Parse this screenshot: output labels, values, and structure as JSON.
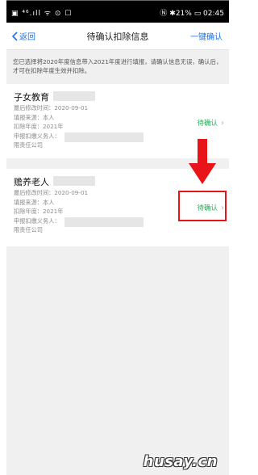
{
  "status_bar": {
    "left": "▣ ⁴⁶.ıll ᯤ ⊙ ☐",
    "right": "Ⓝ ✱21% ▭ 02:45"
  },
  "nav": {
    "back": "返回",
    "title": "待确认扣除信息",
    "confirm_all": "一键确认"
  },
  "notice": "您已选择将2020年度信息带入2021年度进行填报，请确认信息无误，确认后，才可在扣除年度生效并扣除。",
  "records": [
    {
      "title": "子女教育",
      "modified": "最后修改时间：2020-09-01",
      "source": "填报来源：本人",
      "year": "扣除年度：2021年",
      "payer_label": "申报扣缴义务人：",
      "company_suffix": "限责任公司",
      "status": "待确认"
    },
    {
      "title": "赡养老人",
      "modified": "最后修改时间：2020-09-01",
      "source": "填报来源：本人",
      "year": "扣除年度：2021年",
      "payer_label": "申报扣缴义务人：",
      "company_suffix": "限责任公司",
      "status": "待确认"
    }
  ],
  "watermark": "husay.cn",
  "colors": {
    "accent": "#1a73e8",
    "status_green": "#2baa58",
    "annotation_red": "#e8141a"
  }
}
